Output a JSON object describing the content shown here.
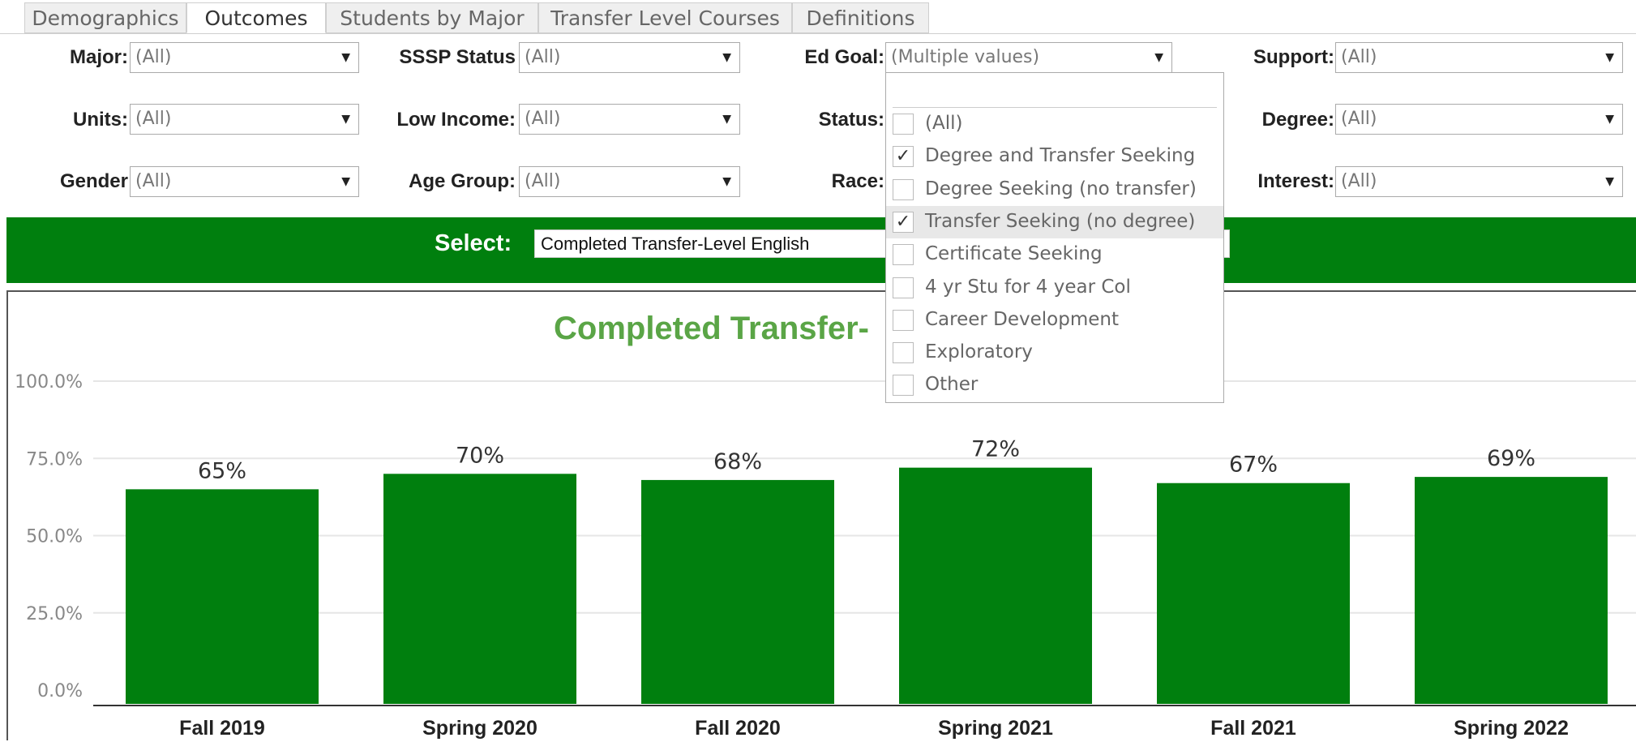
{
  "tabs": [
    {
      "label": "Demographics",
      "active": false
    },
    {
      "label": "Outcomes",
      "active": true
    },
    {
      "label": "Students by Major",
      "active": false
    },
    {
      "label": "Transfer Level Courses",
      "active": false
    },
    {
      "label": "Definitions",
      "active": false
    }
  ],
  "filters": {
    "major": {
      "label": "Major:",
      "value": "(All)"
    },
    "sssp": {
      "label": "SSSP Status",
      "value": "(All)"
    },
    "ed_goal": {
      "label": "Ed Goal:",
      "value": "(Multiple values)"
    },
    "support": {
      "label": "Support:",
      "value": "(All)"
    },
    "units": {
      "label": "Units:",
      "value": "(All)"
    },
    "low_income": {
      "label": "Low Income:",
      "value": "(All)"
    },
    "status": {
      "label": "Status:"
    },
    "degree": {
      "label": "Degree:",
      "value": "(All)"
    },
    "gender": {
      "label": "Gender",
      "value": "(All)"
    },
    "age_group": {
      "label": "Age Group:",
      "value": "(All)"
    },
    "race": {
      "label": "Race:"
    },
    "interest": {
      "label": "Interest:",
      "value": "(All)"
    }
  },
  "select": {
    "label": "Select:",
    "value": "Completed Transfer-Level English"
  },
  "dropdown": {
    "items": [
      {
        "label": "(All)",
        "checked": false
      },
      {
        "label": "Degree and Transfer Seeking",
        "checked": true
      },
      {
        "label": "Degree Seeking (no transfer)",
        "checked": false
      },
      {
        "label": "Transfer Seeking (no degree)",
        "checked": true,
        "highlighted": true
      },
      {
        "label": "Certificate Seeking",
        "checked": false
      },
      {
        "label": "4 yr Stu for 4 year Col",
        "checked": false
      },
      {
        "label": "Career Development",
        "checked": false
      },
      {
        "label": "Exploratory",
        "checked": false
      },
      {
        "label": "Other",
        "checked": false
      }
    ]
  },
  "chart_data": {
    "type": "bar",
    "title": "Completed Transfer-",
    "categories": [
      "Fall 2019",
      "Spring 2020",
      "Fall 2020",
      "Spring 2021",
      "Fall 2021",
      "Spring 2022"
    ],
    "values": [
      65,
      70,
      68,
      72,
      67,
      69
    ],
    "data_labels": [
      "65%",
      "70%",
      "68%",
      "72%",
      "67%",
      "69%"
    ],
    "yticks": [
      "100.0%",
      "75.0%",
      "50.0%",
      "25.0%",
      "0.0%"
    ],
    "ylim": [
      0,
      100
    ],
    "grid": true,
    "bar_color": "#007f0e",
    "title_color": "#5aa546"
  }
}
